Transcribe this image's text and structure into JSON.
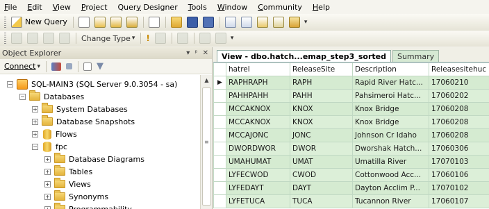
{
  "menu": [
    {
      "u": "F",
      "rest": "ile"
    },
    {
      "u": "E",
      "rest": "dit"
    },
    {
      "u": "V",
      "rest": "iew"
    },
    {
      "u": "P",
      "rest": "roject"
    },
    {
      "pre": "Quer",
      "u": "y",
      "rest": " Designer"
    },
    {
      "u": "T",
      "rest": "ools"
    },
    {
      "u": "W",
      "rest": "indow"
    },
    {
      "u": "C",
      "rest": "ommunity"
    },
    {
      "u": "H",
      "rest": "elp"
    }
  ],
  "toolbar": {
    "new_query_label": "New Query",
    "change_type_label": "Change Type"
  },
  "object_explorer": {
    "title": "Object Explorer",
    "connect_label": "Connect",
    "tree": [
      {
        "level": 0,
        "icon": "server",
        "expander": "−",
        "label": "SQL-MAIN3 (SQL Server 9.0.3054 - sa)"
      },
      {
        "level": 1,
        "icon": "folder",
        "expander": "−",
        "label": "Databases"
      },
      {
        "level": 2,
        "icon": "folder",
        "expander": "+",
        "label": "System Databases"
      },
      {
        "level": 2,
        "icon": "folder",
        "expander": "+",
        "label": "Database Snapshots"
      },
      {
        "level": 2,
        "icon": "database",
        "expander": "+",
        "label": "Flows"
      },
      {
        "level": 2,
        "icon": "database",
        "expander": "−",
        "label": "fpc"
      },
      {
        "level": 3,
        "icon": "folder",
        "expander": "+",
        "label": "Database Diagrams"
      },
      {
        "level": 3,
        "icon": "folder",
        "expander": "+",
        "label": "Tables"
      },
      {
        "level": 3,
        "icon": "folder",
        "expander": "+",
        "label": "Views"
      },
      {
        "level": 3,
        "icon": "folder",
        "expander": "+",
        "label": "Synonyms"
      },
      {
        "level": 3,
        "icon": "folder",
        "expander": "+",
        "label": "Programmability"
      }
    ]
  },
  "document": {
    "tabs": [
      {
        "label": "View - dbo.hatch...emap_step3_sorted",
        "active": true
      },
      {
        "label": "Summary",
        "active": false
      }
    ],
    "columns": [
      "hatrel",
      "ReleaseSite",
      "Description",
      "Releasesitehuc"
    ],
    "rows": [
      {
        "current": true,
        "cells": [
          "RAPHRAPH",
          "RAPH",
          "Rapid River Hatc...",
          "17060210"
        ]
      },
      {
        "current": false,
        "cells": [
          "PAHHPAHH",
          "PAHH",
          "Pahsimeroi Hatc...",
          "17060202"
        ]
      },
      {
        "current": false,
        "cells": [
          "MCCAKNOX",
          "KNOX",
          "Knox Bridge",
          "17060208"
        ]
      },
      {
        "current": false,
        "cells": [
          "MCCAKNOX",
          "KNOX",
          "Knox Bridge",
          "17060208"
        ]
      },
      {
        "current": false,
        "cells": [
          "MCCAJONC",
          "JONC",
          "Johnson Cr Idaho",
          "17060208"
        ]
      },
      {
        "current": false,
        "cells": [
          "DWORDWOR",
          "DWOR",
          "Dworshak Hatch...",
          "17060306"
        ]
      },
      {
        "current": false,
        "cells": [
          "UMAHUMAT",
          "UMAT",
          "Umatilla River",
          "17070103"
        ]
      },
      {
        "current": false,
        "cells": [
          "LYFECWOD",
          "CWOD",
          "Cottonwood Acc...",
          "17060106"
        ]
      },
      {
        "current": false,
        "cells": [
          "LYFEDAYT",
          "DAYT",
          "Dayton Acclim P...",
          "17070102"
        ]
      },
      {
        "current": false,
        "cells": [
          "LYFETUCA",
          "TUCA",
          "Tucannon River",
          "17060107"
        ]
      }
    ]
  }
}
